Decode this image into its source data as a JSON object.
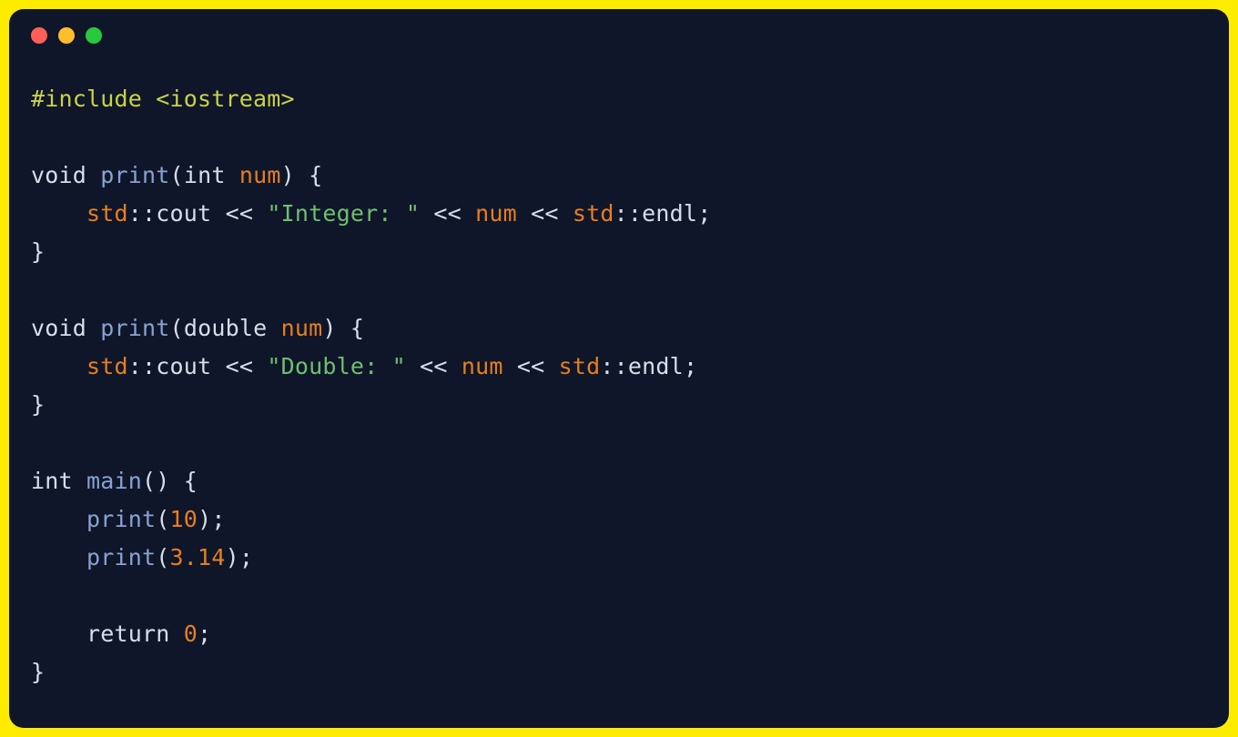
{
  "window": {
    "controls": [
      "close",
      "minimize",
      "maximize"
    ]
  },
  "code": {
    "line1": {
      "include": "#include",
      "header": " <iostream>"
    },
    "line3": {
      "ret": "void",
      "func": "print",
      "open": "(",
      "ptype": "int",
      "pname": "num",
      "close": ") {"
    },
    "line4": {
      "indent": "    ",
      "ns": "std",
      "scope1": "::",
      "cout": "cout",
      "op1": " << ",
      "str": "\"Integer: \"",
      "op2": " << ",
      "var": "num",
      "op3": " << ",
      "ns2": "std",
      "scope2": "::",
      "endl": "endl",
      "semi": ";"
    },
    "line5": {
      "brace": "}"
    },
    "line7": {
      "ret": "void",
      "func": "print",
      "open": "(",
      "ptype": "double",
      "pname": "num",
      "close": ") {"
    },
    "line8": {
      "indent": "    ",
      "ns": "std",
      "scope1": "::",
      "cout": "cout",
      "op1": " << ",
      "str": "\"Double: \"",
      "op2": " << ",
      "var": "num",
      "op3": " << ",
      "ns2": "std",
      "scope2": "::",
      "endl": "endl",
      "semi": ";"
    },
    "line9": {
      "brace": "}"
    },
    "line11": {
      "ret": "int",
      "func": "main",
      "parens": "() {"
    },
    "line12": {
      "indent": "    ",
      "call": "print",
      "open": "(",
      "arg": "10",
      "close": ");"
    },
    "line13": {
      "indent": "    ",
      "call": "print",
      "open": "(",
      "arg": "3.14",
      "close": ");"
    },
    "line15": {
      "indent": "    ",
      "ret": "return",
      "val": " 0",
      "semi": ";"
    },
    "line16": {
      "brace": "}"
    }
  }
}
